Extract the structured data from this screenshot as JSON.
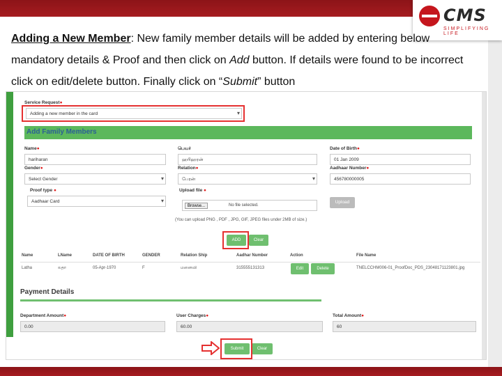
{
  "instructions": {
    "title": "Adding a New Member",
    "part1": ": New family member details will be added by entering below mandatory details & Proof and then click on ",
    "add_word": "Add",
    "part2": " button. If details were found to be incorrect click on edit/delete button. Finally click on “",
    "submit_word": "Submit",
    "part3": "” button"
  },
  "logo": {
    "name": "CMS",
    "tagline": "SIMPLIFYING LIFE"
  },
  "form": {
    "service_request_label": "Service Request",
    "service_request_value": "Adding a new member in the card",
    "section_title": "Add Family Members",
    "name_label": "Name",
    "name_value": "hariharan",
    "name_tamil_label": "பெயர்",
    "name_tamil_value": "ஹரிஹரன்",
    "dob_label": "Date of Birth",
    "dob_value": "01 Jan 2009",
    "gender_label": "Gender",
    "gender_value": "Select Gender",
    "relation_label": "Relation",
    "relation_value": "பேரன்",
    "aadhar_label": "Aadhaar Number",
    "aadhar_value": "456780000005",
    "proof_type_label": "Proof type",
    "proof_type_value": "Aadhaar Card",
    "upload_label": "Upload file",
    "choose_button": "Browse...",
    "no_file": "No file selected.",
    "upload_button": "Upload",
    "upload_note": "(You can upload PNG , PDF , JPG, GIF, JPEG files under 2MB of size.)",
    "add_button": "ADD",
    "clear_button": "Clear"
  },
  "table": {
    "headers": [
      "Name",
      "LName",
      "DATE OF BIRTH",
      "GENDER",
      "Relation Ship",
      "Aadhar Number",
      "Action",
      "File Name"
    ],
    "row": {
      "name": "Latha",
      "lname": "லதா",
      "dob": "05-Apr-1970",
      "gender": "F",
      "relation": "மனைவி",
      "aadhar": "315555131313",
      "edit": "Edit",
      "delete": "Delete",
      "file": "TNELCCHM006-01_ProofDoc_PDS_23048171123801.jpg"
    }
  },
  "payment": {
    "title": "Payment Details",
    "dept_label": "Department Amount",
    "dept_value": "0.00",
    "user_label": "User Charges",
    "user_value": "60.00",
    "total_label": "Total Amount",
    "total_value": "60",
    "submit_button": "Submit",
    "clear_button": "Clear"
  },
  "colors": {
    "brand_red": "#a61c20",
    "green": "#5cb85c",
    "highlight": "#e53030"
  }
}
